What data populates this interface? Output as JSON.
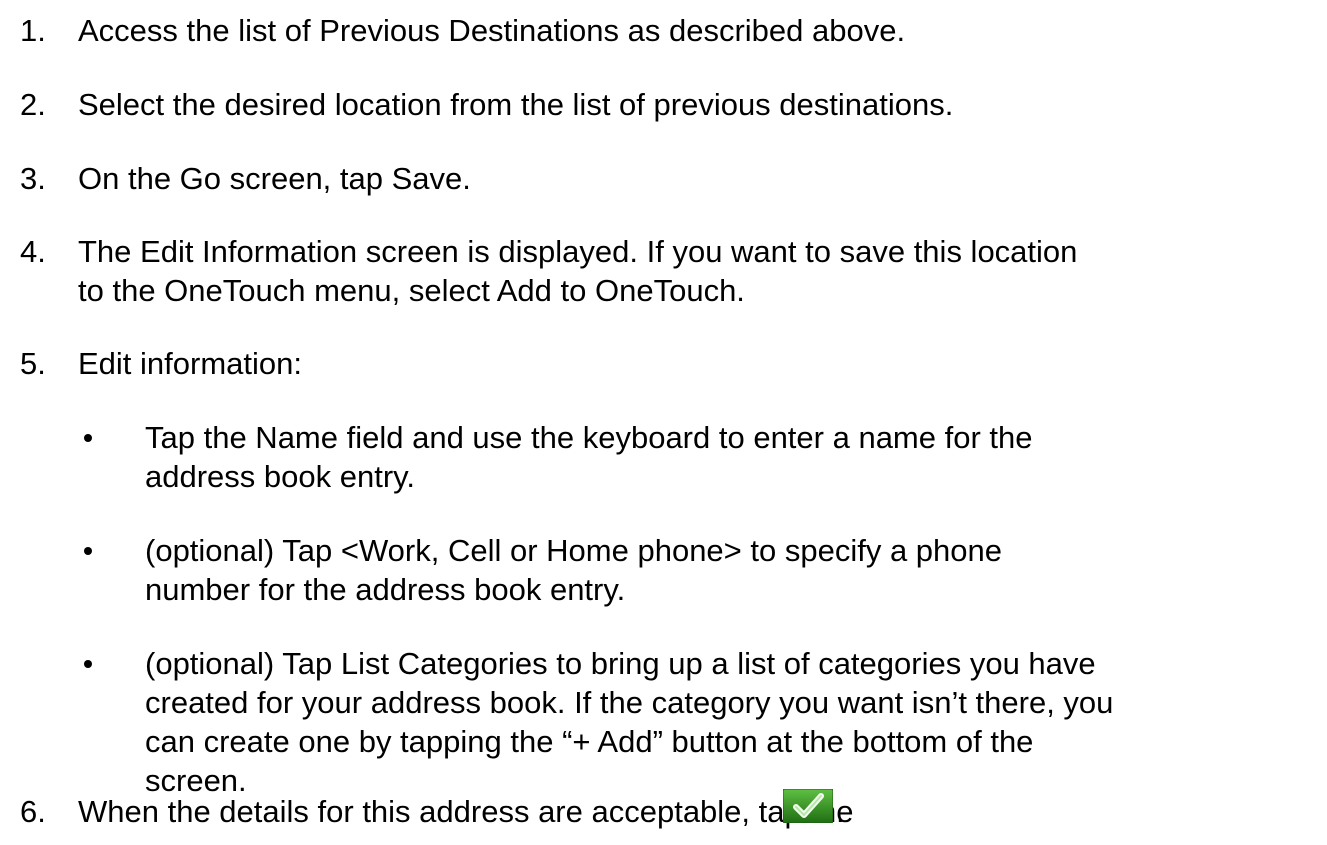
{
  "steps": [
    {
      "number": "1.",
      "lines": [
        "Access the list of Previous Destinations as described above."
      ]
    },
    {
      "number": "2.",
      "lines": [
        "Select the desired location from the list of previous destinations."
      ]
    },
    {
      "number": "3.",
      "lines": [
        "On the Go screen, tap Save."
      ]
    },
    {
      "number": "4.",
      "lines": [
        "The Edit Information screen is displayed. If you want to save this location",
        "to the OneTouch menu, select Add to OneTouch."
      ]
    },
    {
      "number": "5.",
      "lines": [
        "Edit information:"
      ]
    },
    {
      "number": "6.",
      "lines": [
        "When the details for this address are acceptable, tap the",
        "."
      ]
    }
  ],
  "bullets": [
    {
      "lines": [
        "Tap the Name field and use the keyboard to enter a name for the",
        "address book entry."
      ]
    },
    {
      "lines": [
        "(optional) Tap <Work, Cell or Home phone> to specify a phone",
        "number for the address book entry."
      ]
    },
    {
      "lines": [
        "(optional) Tap List Categories to bring up a list of categories you have",
        "created for your address book. If the category you want isn’t there, you",
        "can create one by tapping the “+ Add” button at the bottom of the",
        "screen."
      ]
    }
  ],
  "icons": {
    "accept": "checkmark-icon",
    "accept_bg": "#2f8a1c",
    "accept_check": "#e8f7e0"
  }
}
